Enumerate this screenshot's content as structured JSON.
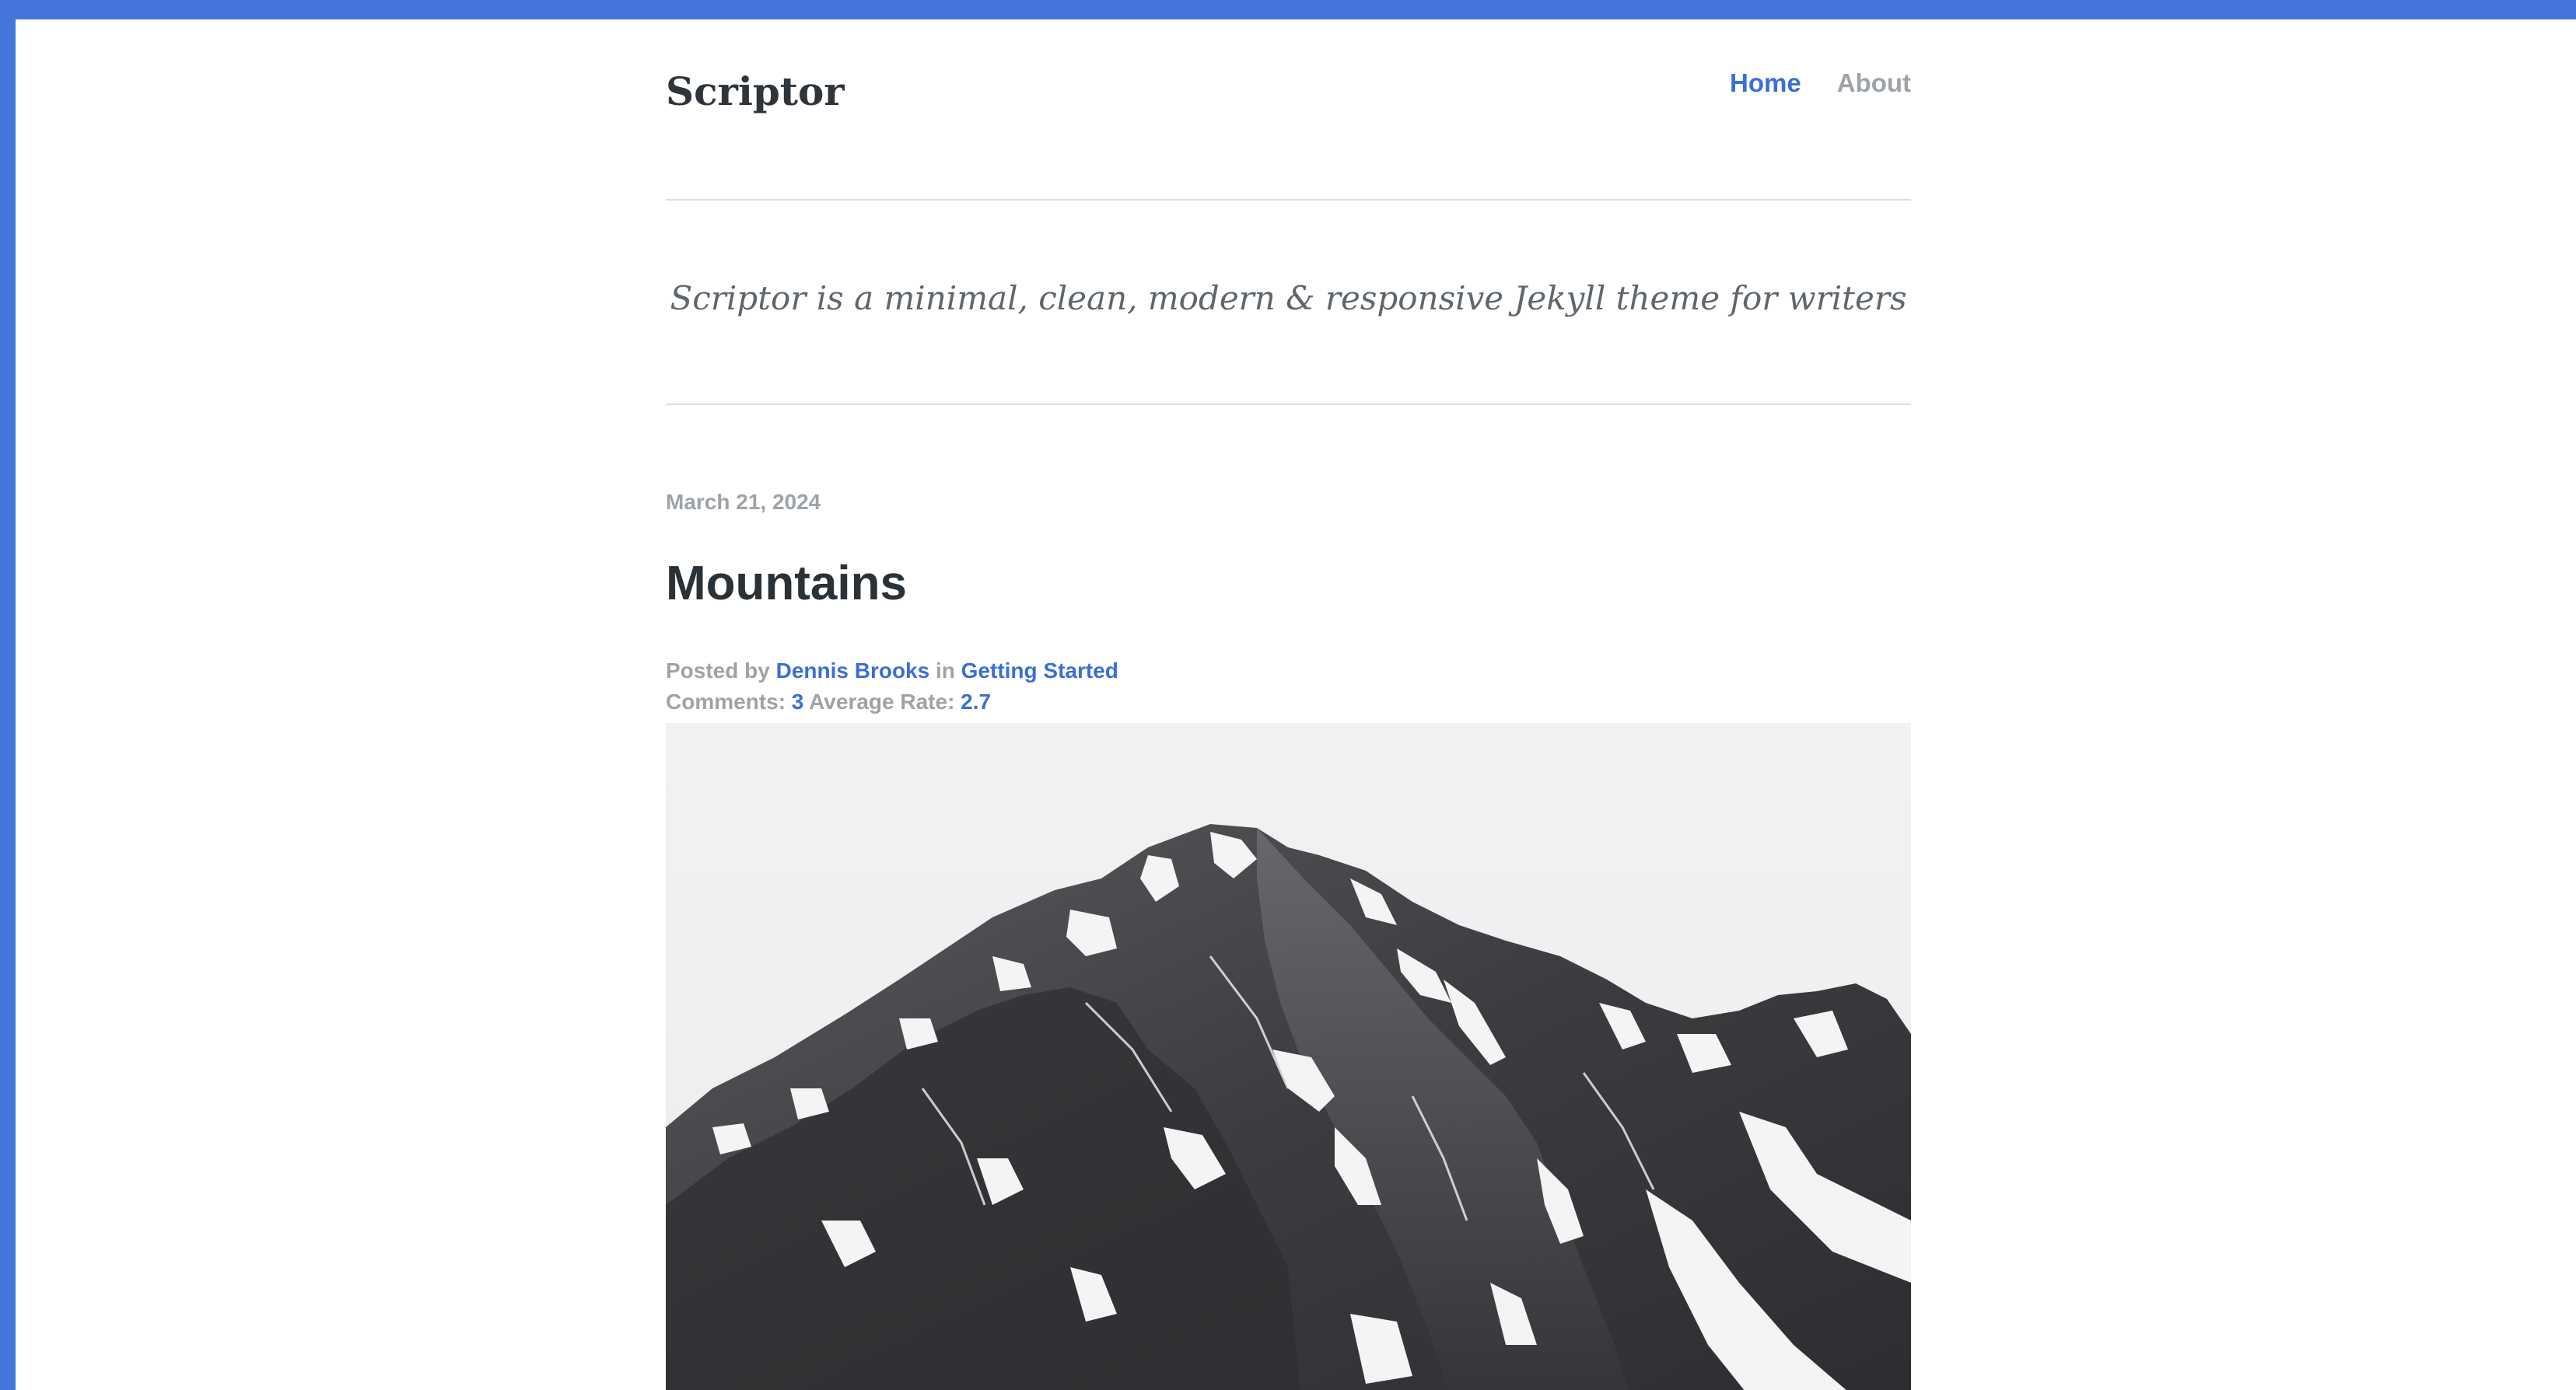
{
  "header": {
    "site_title": "Scriptor",
    "nav": [
      {
        "label": "Home",
        "active": true
      },
      {
        "label": "About",
        "active": false
      }
    ]
  },
  "tagline": "Scriptor is a minimal, clean, modern & responsive Jekyll theme for writers",
  "post": {
    "date": "March 21, 2024",
    "title": "Mountains",
    "posted_by_label": "Posted by",
    "author": "Dennis Brooks",
    "in_label": "in",
    "category": "Getting Started",
    "comments_label": "Comments:",
    "comments_count": "3",
    "rate_label": "Average Rate:",
    "rate_value": "2.7",
    "image_alt": "mountain-photo"
  },
  "colors": {
    "accent": "#3b6fd4",
    "frame_border": "#4575db",
    "muted_text": "#9ea3a8",
    "heading_text": "#2a3137"
  }
}
